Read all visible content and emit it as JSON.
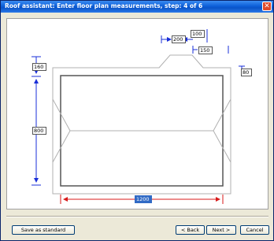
{
  "window": {
    "title": "Roof assistant: Enter floor plan measurements, step: 4 of 6",
    "close_glyph": "✕"
  },
  "measurements": {
    "top_left_gap": "200",
    "top_ridge": "100",
    "top_right_gap": "150",
    "left_top": "160",
    "right_top": "80",
    "left_height": "800",
    "bottom_width": "1200"
  },
  "buttons": {
    "save_as_standard": "Save as standard",
    "back": "< Back",
    "next": "Next >",
    "cancel": "Cancel"
  },
  "colors": {
    "title_bar": "#0a54c8",
    "dimension_arrows_vertical": "#1a2fd8",
    "dimension_arrows_horizontal": "#d81a1a",
    "close_button": "#e04a2a"
  }
}
